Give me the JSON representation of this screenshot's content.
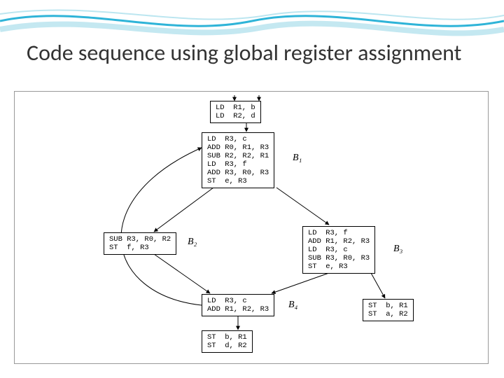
{
  "title": "Code sequence using global register assignment",
  "blocks": {
    "entry": "LD  R1, b\nLD  R2, d",
    "b1": "LD  R3, c\nADD R0, R1, R3\nSUB R2, R2, R1\nLD  R3, f\nADD R3, R0, R3\nST  e, R3",
    "b2": "SUB R3, R0, R2\nST  f, R3",
    "b3": "LD  R3, f\nADD R1, R2, R3\nLD  R3, c\nSUB R3, R0, R3\nST  e, R3",
    "b4": "LD  R3, c\nADD R1, R2, R3",
    "b3x": "ST  b, R1\nST  a, R2",
    "exit": "ST  b, R1\nST  d, R2"
  },
  "labels": {
    "b1": "B₁",
    "b2": "B₂",
    "b3": "B₃",
    "b4": "B₄"
  }
}
